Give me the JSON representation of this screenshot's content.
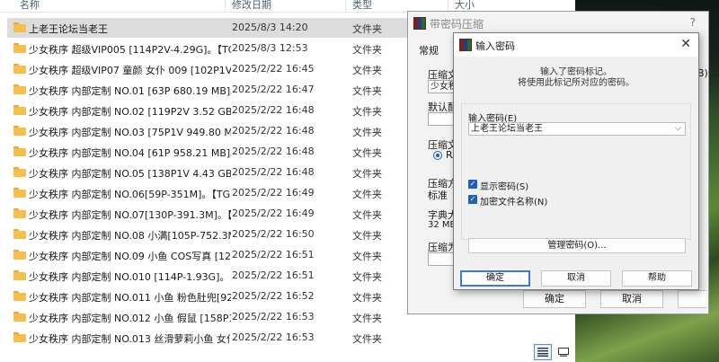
{
  "explorer": {
    "columns": {
      "name": "名称",
      "date": "修改日期",
      "type": "类型",
      "size": "大小"
    },
    "rows": [
      {
        "name": "上老王论坛当老王",
        "date": "2025/8/3 14:20",
        "type": "文件夹"
      },
      {
        "name": "少女秩序 超级VIP005 [114P2V-4.29G]。【TG...",
        "date": "2025/8/3 12:53",
        "type": "文件夹"
      },
      {
        "name": "少女秩序 超级VIP07 童颜 女仆 009 [102P1V-3...",
        "date": "2025/2/22 16:45",
        "type": "文件夹"
      },
      {
        "name": "少女秩序 内部定制 NO.01 [63P 680.19 MB]。...",
        "date": "2025/2/22 16:47",
        "type": "文件夹"
      },
      {
        "name": "少女秩序 内部定制 NO.02 [119P2V 3.52 GB]...",
        "date": "2025/2/22 16:48",
        "type": "文件夹"
      },
      {
        "name": "少女秩序 内部定制 NO.03 [75P1V 949.80 MB...",
        "date": "2025/2/22 16:48",
        "type": "文件夹"
      },
      {
        "name": "少女秩序 内部定制 NO.04 [61P 958.21 MB]。...",
        "date": "2025/2/22 16:48",
        "type": "文件夹"
      },
      {
        "name": "少女秩序 内部定制 NO.05 [138P1V 4.43 GB]...",
        "date": "2025/2/22 16:48",
        "type": "文件夹"
      },
      {
        "name": "少女秩序 内部定制 NO.06[59P-351M]。【TG...",
        "date": "2025/2/22 16:49",
        "type": "文件夹"
      },
      {
        "name": "少女秩序 内部定制 NO.07[130P-391.3M]。【...",
        "date": "2025/2/22 16:49",
        "type": "文件夹"
      },
      {
        "name": "少女秩序 内部定制 NO.08 小满[105P-752.3M...",
        "date": "2025/2/22 16:50",
        "type": "文件夹"
      },
      {
        "name": "少女秩序 内部定制 NO.09 小鱼 COS写真 [125...",
        "date": "2025/2/22 16:51",
        "type": "文件夹"
      },
      {
        "name": "少女秩序 内部定制 NO.010 [114P-1.93G]。【...",
        "date": "2025/2/22 16:51",
        "type": "文件夹"
      },
      {
        "name": "少女秩序 内部定制 NO.011 小鱼 粉色肚兜[92...",
        "date": "2025/2/22 16:52",
        "type": "文件夹"
      },
      {
        "name": "少女秩序 内部定制 NO.012 小鱼 假鼠 [158P1...",
        "date": "2025/2/22 16:53",
        "type": "文件夹"
      },
      {
        "name": "少女秩序 内部定制 NO.013 丝滑萝莉小鱼 女仆...",
        "date": "2025/2/22 16:53",
        "type": "文件夹"
      }
    ],
    "view_icons": {
      "details": "details-view-icon",
      "tiles": "tiles-view-icon"
    }
  },
  "back_dialog": {
    "title": "带密码压缩",
    "help": "?",
    "tab_general": "常规",
    "label_archive": "压缩文",
    "field_archive": "少女秩",
    "label_default": "默认配",
    "label_format": "压缩文",
    "radio_rar": "RA",
    "label_method": "压缩方",
    "field_method": "标准",
    "label_dict": "字典大",
    "field_dict": "32 MB",
    "label_split": "压缩为",
    "right_fragment": "B)...",
    "ok": "确定",
    "cancel": "取消",
    "help_btn": "帮助"
  },
  "front_dialog": {
    "title": "输入密码",
    "info_line1": "输入了密码标记。",
    "info_line2": "将使用此标记所对应的密码。",
    "password_label": "输入密码(E)",
    "password_value": "上老王论坛当老王",
    "show_password": "显示密码(S)",
    "encrypt_names": "加密文件名称(N)",
    "manage": "管理密码(O)...",
    "ok": "确定",
    "cancel": "取消",
    "help": "帮助"
  }
}
